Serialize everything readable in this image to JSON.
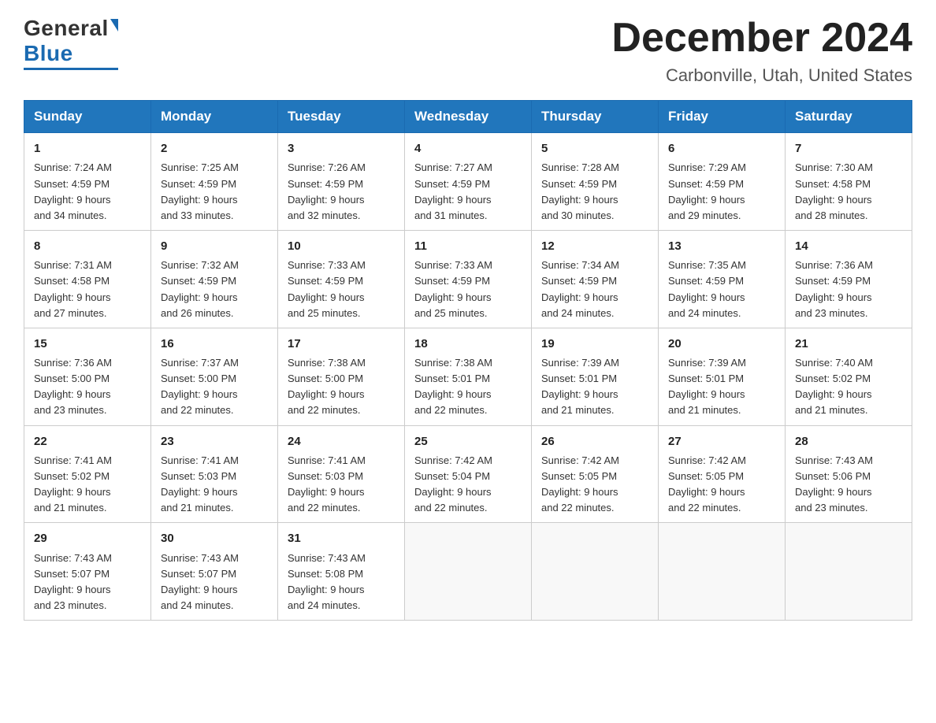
{
  "header": {
    "logo": {
      "general": "General",
      "blue": "Blue",
      "underline_color": "#1a6ab1"
    },
    "title": "December 2024",
    "location": "Carbonville, Utah, United States"
  },
  "weekdays": [
    "Sunday",
    "Monday",
    "Tuesday",
    "Wednesday",
    "Thursday",
    "Friday",
    "Saturday"
  ],
  "weeks": [
    [
      {
        "day": "1",
        "sunrise": "7:24 AM",
        "sunset": "4:59 PM",
        "daylight": "9 hours and 34 minutes."
      },
      {
        "day": "2",
        "sunrise": "7:25 AM",
        "sunset": "4:59 PM",
        "daylight": "9 hours and 33 minutes."
      },
      {
        "day": "3",
        "sunrise": "7:26 AM",
        "sunset": "4:59 PM",
        "daylight": "9 hours and 32 minutes."
      },
      {
        "day": "4",
        "sunrise": "7:27 AM",
        "sunset": "4:59 PM",
        "daylight": "9 hours and 31 minutes."
      },
      {
        "day": "5",
        "sunrise": "7:28 AM",
        "sunset": "4:59 PM",
        "daylight": "9 hours and 30 minutes."
      },
      {
        "day": "6",
        "sunrise": "7:29 AM",
        "sunset": "4:59 PM",
        "daylight": "9 hours and 29 minutes."
      },
      {
        "day": "7",
        "sunrise": "7:30 AM",
        "sunset": "4:58 PM",
        "daylight": "9 hours and 28 minutes."
      }
    ],
    [
      {
        "day": "8",
        "sunrise": "7:31 AM",
        "sunset": "4:58 PM",
        "daylight": "9 hours and 27 minutes."
      },
      {
        "day": "9",
        "sunrise": "7:32 AM",
        "sunset": "4:59 PM",
        "daylight": "9 hours and 26 minutes."
      },
      {
        "day": "10",
        "sunrise": "7:33 AM",
        "sunset": "4:59 PM",
        "daylight": "9 hours and 25 minutes."
      },
      {
        "day": "11",
        "sunrise": "7:33 AM",
        "sunset": "4:59 PM",
        "daylight": "9 hours and 25 minutes."
      },
      {
        "day": "12",
        "sunrise": "7:34 AM",
        "sunset": "4:59 PM",
        "daylight": "9 hours and 24 minutes."
      },
      {
        "day": "13",
        "sunrise": "7:35 AM",
        "sunset": "4:59 PM",
        "daylight": "9 hours and 24 minutes."
      },
      {
        "day": "14",
        "sunrise": "7:36 AM",
        "sunset": "4:59 PM",
        "daylight": "9 hours and 23 minutes."
      }
    ],
    [
      {
        "day": "15",
        "sunrise": "7:36 AM",
        "sunset": "5:00 PM",
        "daylight": "9 hours and 23 minutes."
      },
      {
        "day": "16",
        "sunrise": "7:37 AM",
        "sunset": "5:00 PM",
        "daylight": "9 hours and 22 minutes."
      },
      {
        "day": "17",
        "sunrise": "7:38 AM",
        "sunset": "5:00 PM",
        "daylight": "9 hours and 22 minutes."
      },
      {
        "day": "18",
        "sunrise": "7:38 AM",
        "sunset": "5:01 PM",
        "daylight": "9 hours and 22 minutes."
      },
      {
        "day": "19",
        "sunrise": "7:39 AM",
        "sunset": "5:01 PM",
        "daylight": "9 hours and 21 minutes."
      },
      {
        "day": "20",
        "sunrise": "7:39 AM",
        "sunset": "5:01 PM",
        "daylight": "9 hours and 21 minutes."
      },
      {
        "day": "21",
        "sunrise": "7:40 AM",
        "sunset": "5:02 PM",
        "daylight": "9 hours and 21 minutes."
      }
    ],
    [
      {
        "day": "22",
        "sunrise": "7:41 AM",
        "sunset": "5:02 PM",
        "daylight": "9 hours and 21 minutes."
      },
      {
        "day": "23",
        "sunrise": "7:41 AM",
        "sunset": "5:03 PM",
        "daylight": "9 hours and 21 minutes."
      },
      {
        "day": "24",
        "sunrise": "7:41 AM",
        "sunset": "5:03 PM",
        "daylight": "9 hours and 22 minutes."
      },
      {
        "day": "25",
        "sunrise": "7:42 AM",
        "sunset": "5:04 PM",
        "daylight": "9 hours and 22 minutes."
      },
      {
        "day": "26",
        "sunrise": "7:42 AM",
        "sunset": "5:05 PM",
        "daylight": "9 hours and 22 minutes."
      },
      {
        "day": "27",
        "sunrise": "7:42 AM",
        "sunset": "5:05 PM",
        "daylight": "9 hours and 22 minutes."
      },
      {
        "day": "28",
        "sunrise": "7:43 AM",
        "sunset": "5:06 PM",
        "daylight": "9 hours and 23 minutes."
      }
    ],
    [
      {
        "day": "29",
        "sunrise": "7:43 AM",
        "sunset": "5:07 PM",
        "daylight": "9 hours and 23 minutes."
      },
      {
        "day": "30",
        "sunrise": "7:43 AM",
        "sunset": "5:07 PM",
        "daylight": "9 hours and 24 minutes."
      },
      {
        "day": "31",
        "sunrise": "7:43 AM",
        "sunset": "5:08 PM",
        "daylight": "9 hours and 24 minutes."
      },
      null,
      null,
      null,
      null
    ]
  ],
  "labels": {
    "sunrise": "Sunrise:",
    "sunset": "Sunset:",
    "daylight": "Daylight:"
  }
}
